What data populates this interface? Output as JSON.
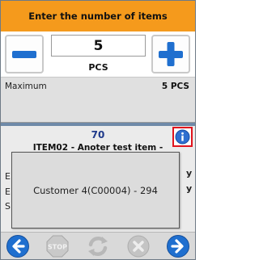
{
  "header": {
    "title": "Enter the number of items"
  },
  "quantity": {
    "value": "5",
    "unit": "PCS"
  },
  "limits": {
    "maximum_label": "Maximum",
    "maximum_value": "5 PCS"
  },
  "item": {
    "number": "70",
    "name": "ITEM02 - Anoter test item -"
  },
  "hidden_row_edges": {
    "row1_left": "E",
    "row2_left": "E",
    "row3_left": "S",
    "right_mark": "y"
  },
  "popup": {
    "text": "Customer 4(C00004) - 294"
  },
  "toolbar": {
    "back_icon": "arrow-left-icon",
    "stop_icon": "stop-icon",
    "refresh_icon": "refresh-icon",
    "cancel_icon": "x-circle-icon",
    "forward_icon": "arrow-right-icon"
  },
  "colors": {
    "title_bar": "#f59a1c",
    "accent_blue": "#1f6fcf",
    "item_number": "#1f3a8a",
    "info_border": "#e0141e",
    "disabled": "#b5b5b5"
  }
}
